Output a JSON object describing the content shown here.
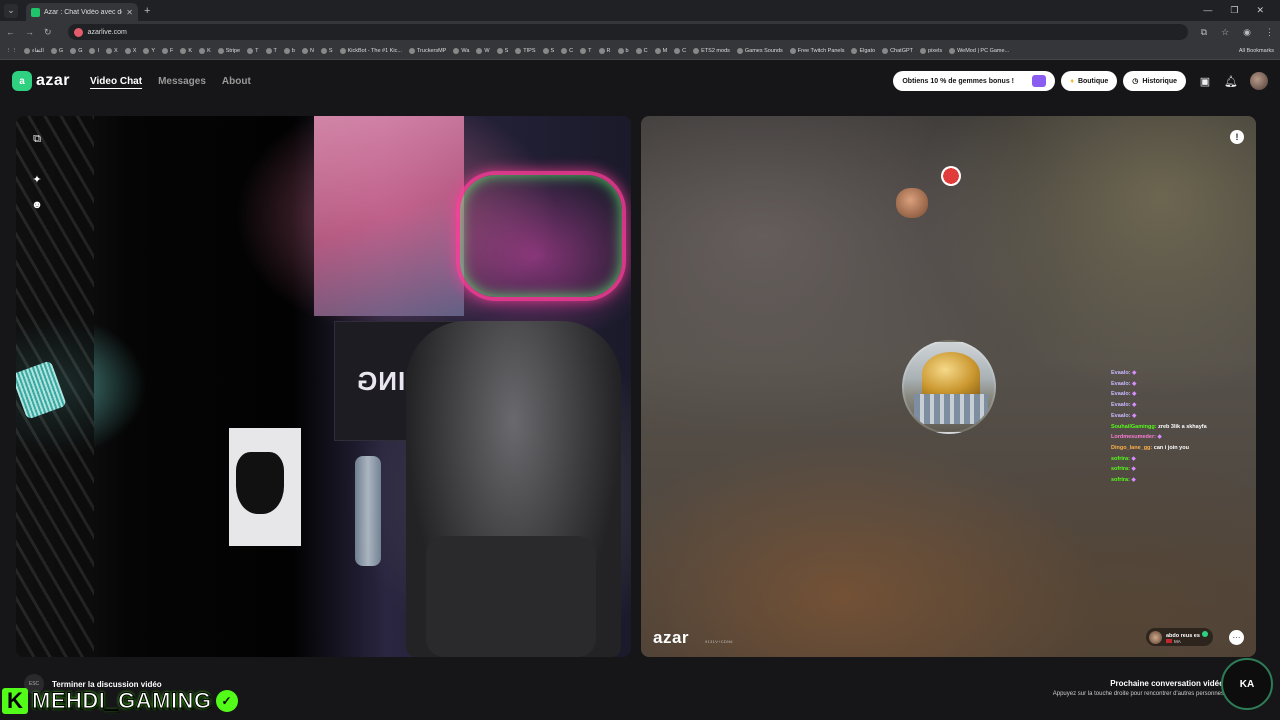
{
  "browser": {
    "tab_title": "Azar : Chat Vidéo avec des i",
    "url": "azarlive.com",
    "bookmarks": [
      "التقاء",
      "G",
      "G",
      "I",
      "X",
      "X",
      "Y",
      "F",
      "K",
      "K",
      "Stripe",
      "T",
      "T",
      "b",
      "N",
      "S",
      "KickBot - The #1 Kic...",
      "TruckersMP",
      "Wa",
      "W",
      "S",
      "TIPS",
      "S",
      "C",
      "T",
      "R",
      "b",
      "C",
      "M",
      "C",
      "ETS2 mods",
      "Games Sounds",
      "Free Twitch Panels",
      "Elgato",
      "ChatGPT",
      "pixels",
      "WeMod | PC Game..."
    ],
    "all_bookmarks": "All Bookmarks"
  },
  "nav": {
    "logo": "azar",
    "links": [
      "Video Chat",
      "Messages",
      "About"
    ],
    "promo": "Obtiens 10 % de gemmes bonus !",
    "shop": "Boutique",
    "history": "Historique"
  },
  "remote": {
    "watermark": "azar",
    "watermark_sub": "9131V+CDN6",
    "partner_name": "abdo reus es",
    "partner_country": "MA"
  },
  "chat": [
    {
      "user": "Evaalo:",
      "msg": "",
      "color": "#c8b8ff"
    },
    {
      "user": "Evaalo:",
      "msg": "",
      "color": "#c8b8ff"
    },
    {
      "user": "Evaalo:",
      "msg": "",
      "color": "#c8b8ff"
    },
    {
      "user": "Evaalo:",
      "msg": "",
      "color": "#c8b8ff"
    },
    {
      "user": "Evaalo:",
      "msg": "",
      "color": "#c8b8ff"
    },
    {
      "user": "SouhailGamingg:",
      "msg": "zreb 3lik a skhayfa",
      "color": "#53fc18"
    },
    {
      "user": "Lordmesumeder:",
      "msg": "",
      "color": "#ff7ad9"
    },
    {
      "user": "Dingo_lane_gg:",
      "msg": "can i join you",
      "color": "#ffb04a"
    },
    {
      "user": "sofrira:",
      "msg": "",
      "color": "#53fc18"
    },
    {
      "user": "sofrira:",
      "msg": "",
      "color": "#53fc18"
    },
    {
      "user": "sofrira:",
      "msg": "",
      "color": "#53fc18"
    }
  ],
  "bottom": {
    "esc": "ESC",
    "end_label": "Terminer la discussion vidéo",
    "next_title": "Prochaine conversation vidéo",
    "next_sub": "Appuyez sur la touche droite pour rencontrer d'autres personnes"
  },
  "overlay": {
    "kick_letter": "K",
    "streamer_name": "MEHDI_GAMING",
    "team": "KA"
  },
  "left_video": {
    "banner_text": "GAMING"
  }
}
